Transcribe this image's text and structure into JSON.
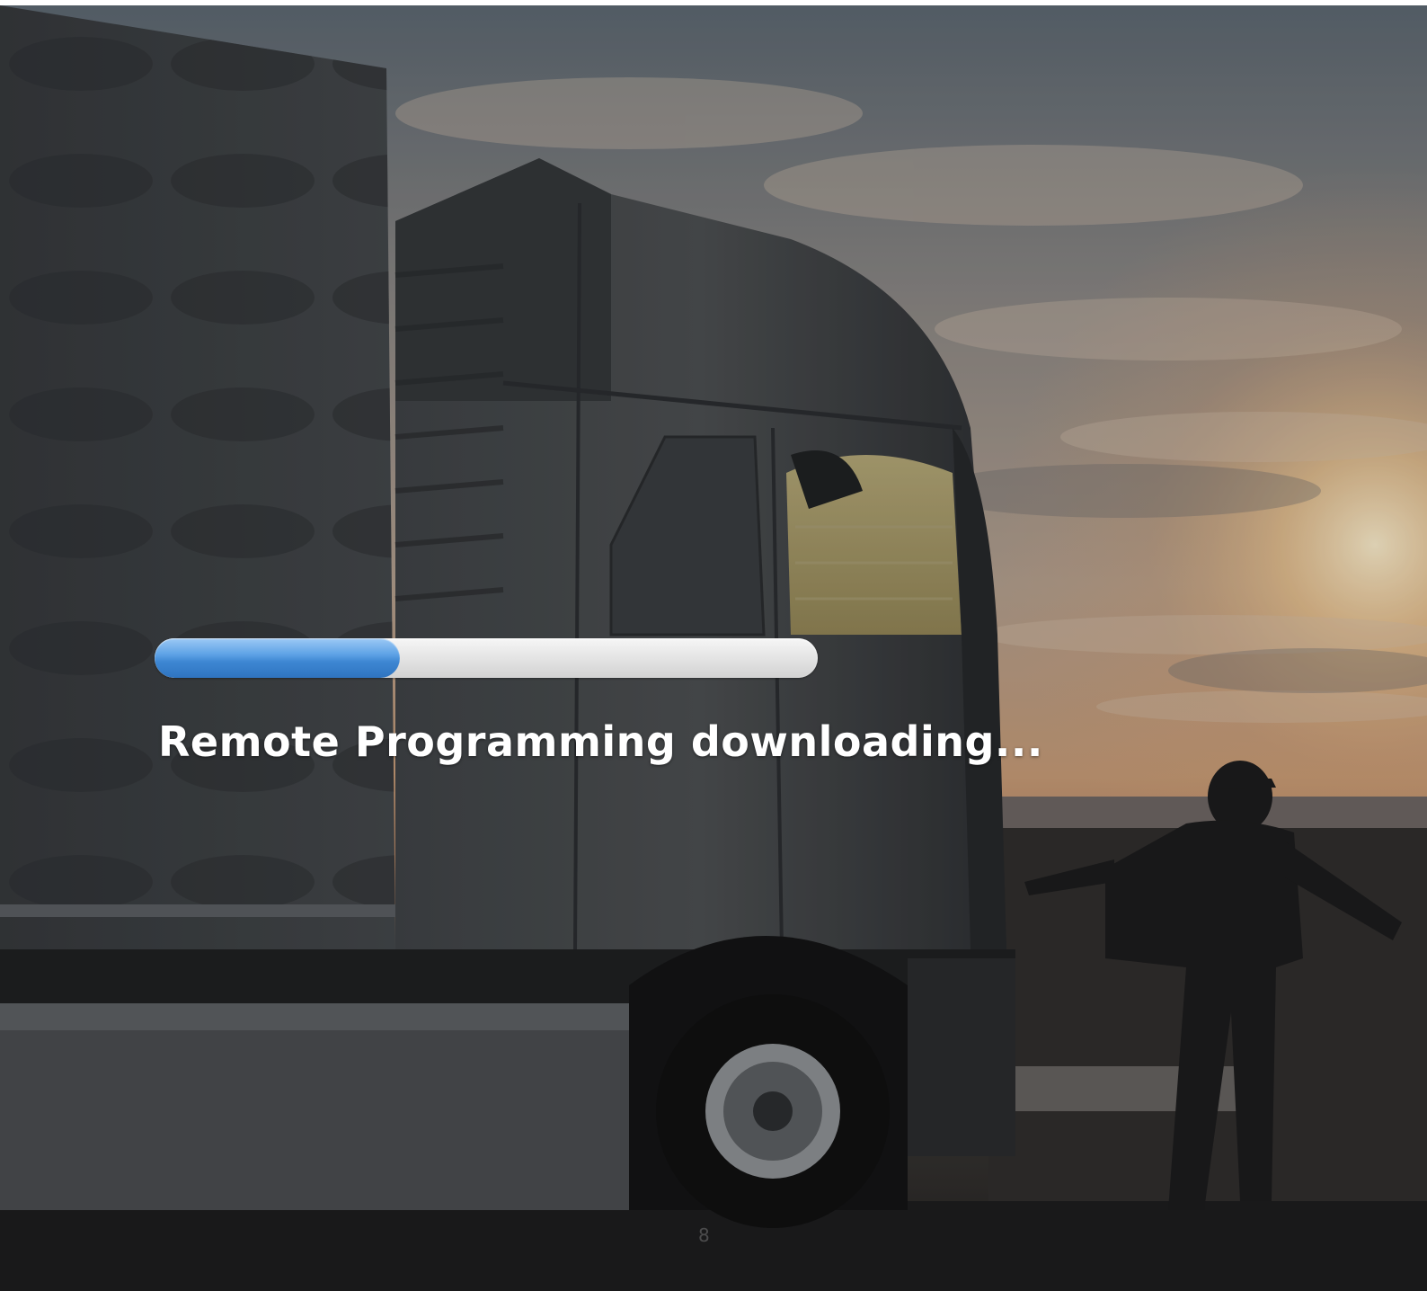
{
  "progress": {
    "fraction": 0.37,
    "fill_color": "#3d86d2",
    "track_color": "#e4e4e4"
  },
  "status": {
    "text": "Remote Programming downloading..."
  },
  "page": {
    "number": "8"
  },
  "background": {
    "icon": "truck-at-sunset-photo"
  }
}
